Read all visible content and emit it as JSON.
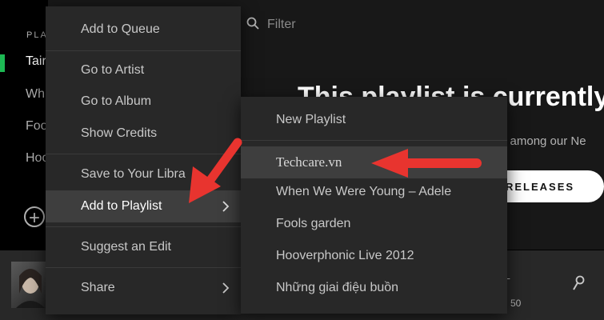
{
  "sidebar": {
    "heading": "PLA",
    "items": [
      "Tair",
      "Wh",
      "Foo",
      "Hoo"
    ]
  },
  "main": {
    "filter_placeholder": "Filter",
    "headline": "This playlist is currently",
    "subline": "e among our Ne",
    "releases_button": "RELEASES"
  },
  "player": {
    "time": "50"
  },
  "context_menu": {
    "items": {
      "add_to_queue": "Add to Queue",
      "go_to_artist": "Go to Artist",
      "go_to_album": "Go to Album",
      "show_credits": "Show Credits",
      "save_to_library": "Save to Your Libra",
      "add_to_playlist": "Add to Playlist",
      "suggest_edit": "Suggest an Edit",
      "share": "Share"
    }
  },
  "submenu": {
    "new_playlist": "New Playlist",
    "highlighted": "Techcare.vn",
    "playlists": [
      "When We Were Young – Adele",
      "Fools garden",
      "Hooverphonic Live 2012",
      "Những giai điệu buồn"
    ]
  },
  "colors": {
    "spotify_green": "#1db954",
    "menu_bg": "#282828",
    "menu_hover": "#3e3e3e",
    "annotation_arrow": "#e8342f"
  }
}
